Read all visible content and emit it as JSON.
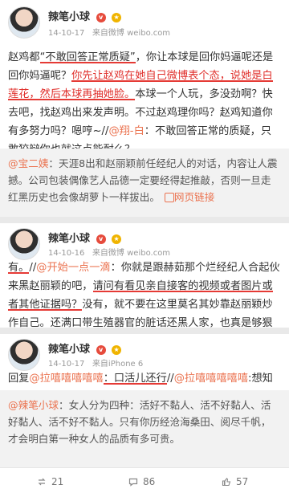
{
  "posts": [
    {
      "user": "辣笔小球",
      "date": "14-10-17",
      "source": "来自微博 weibo.com",
      "text": {
        "p1": "赵鸡都",
        "hl1": "“不敢回答正常质疑”",
        "p2": "，你让本球是回你妈逼呢还是回你妈逼呢？",
        "hl2": "你先让赵鸡在她自己微博表个态，说她是白莲花，然后本球再抽她脸。",
        "p3": "本球一个人玩，多没劲啊？快去吧，找赵鸡出来发声明。不过赵鸡理你吗？赵鸡知道你有多努力吗？嗯哼~//",
        "mention": "@翔-白",
        "p4": "：不敢回答正常的质疑，只敢狡辩你也就这点能耐么？"
      },
      "quote": {
        "mention": "@宝二姨",
        "text": "：天涯8出和赵丽颖前任经纪人的对话，内容让人震撼。公司包装偶像艺人品德一定要经得起推敲，否则一旦走红黑历史也会像胡萝卜一样拔出。",
        "link": "网页链接"
      }
    },
    {
      "user": "辣笔小球",
      "date": "14-10-16",
      "source": "来自微博 weibo.com",
      "text": {
        "hl0": "有。",
        "p1": "//",
        "mention": "@开始一点一滴",
        "p2": "：你就是跟赫茹那个烂经纪人合起伙来黑赵丽颖的吧，",
        "hl1": "请问有看见亲自接客的视频或者图片或者其他证据吗？",
        "p3": "没有，就不要在这里莫名其妙靠赵丽颖炒作自己。还满口带生殖器官的脏话还黑人家，也真是够狠的，总有一天你会遭报应的。恶人有恶报"
      }
    },
    {
      "user": "辣笔小球",
      "date": "14-10-17",
      "source": "来自iPhone 6",
      "text": {
        "p1": "回复",
        "mention1": "@拉嘻嘻嘻嘻嘻",
        "hl1": "：口活儿还行",
        "p2": "//",
        "mention2": "@拉嘻嘻嘻嘻嘻",
        "p3": ":想知道v姐赵丽颖活好不好"
      },
      "quote": {
        "mention": "@辣笔小球",
        "text": "：女人分为四种：活好不黏人、活不好黏人、活好黏人、活不好不黏人。只有你历经沧海桑田、阅尽千帆，才会明白第一种女人的品质有多可贵。"
      }
    }
  ],
  "footer": {
    "reposts": "21",
    "comments": "86",
    "likes": "57"
  },
  "icons": {
    "badge1": "v",
    "badge2": "★"
  }
}
